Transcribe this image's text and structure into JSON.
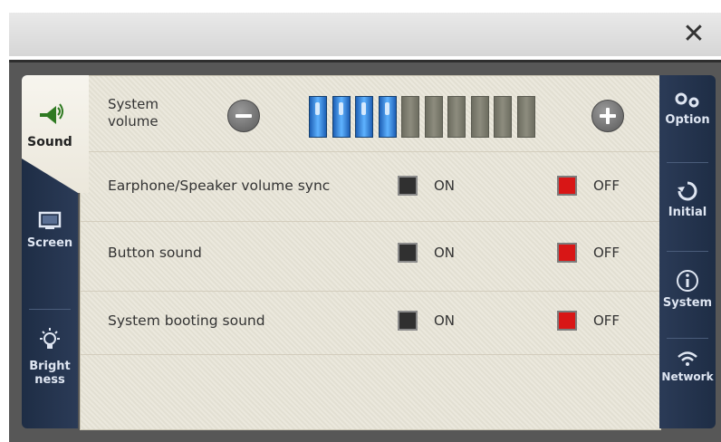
{
  "window": {
    "close_glyph": "✕"
  },
  "left_tabs": [
    {
      "label": "Sound",
      "icon": "speaker-icon",
      "active": true
    },
    {
      "label": "Screen",
      "icon": "monitor-icon",
      "active": false
    },
    {
      "label": "Bright",
      "label2": "ness",
      "icon": "lightbulb-icon",
      "active": false
    }
  ],
  "sound": {
    "volume_label_1": "System",
    "volume_label_2": "volume",
    "volume_level": 4,
    "volume_max": 10,
    "settings": [
      {
        "label": "Earphone/Speaker volume sync",
        "on_label": "ON",
        "off_label": "OFF",
        "selected": "OFF"
      },
      {
        "label": "Button sound",
        "on_label": "ON",
        "off_label": "OFF",
        "selected": "OFF"
      },
      {
        "label": "System booting sound",
        "on_label": "ON",
        "off_label": "OFF",
        "selected": "OFF"
      }
    ]
  },
  "right_tabs": [
    {
      "label": "Option",
      "icon": "gears-icon"
    },
    {
      "label": "Initial",
      "icon": "refresh-icon"
    },
    {
      "label": "System",
      "icon": "info-icon"
    },
    {
      "label": "Network",
      "icon": "wifi-icon"
    }
  ],
  "colors": {
    "active_volume": "#3b8ee0",
    "off_selected": "#d81616",
    "strip": "#24344f"
  }
}
